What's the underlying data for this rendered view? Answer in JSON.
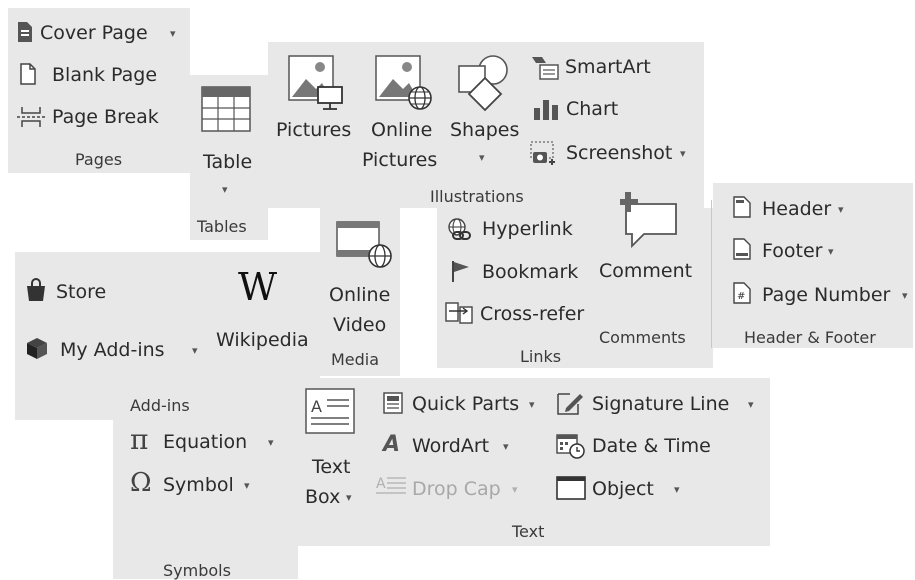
{
  "pages": {
    "cover_page": "Cover Page",
    "blank_page": "Blank Page",
    "page_break": "Page Break",
    "group_label": "Pages"
  },
  "tables": {
    "table_label": "Table",
    "group_label": "Tables"
  },
  "illustrations": {
    "pictures": "Pictures",
    "online_line1": "Online",
    "online_line2": "Pictures",
    "shapes": "Shapes",
    "smartart": "SmartArt",
    "chart": "Chart",
    "screenshot": "Screenshot",
    "group_label": "Illustrations"
  },
  "media": {
    "online_line1": "Online",
    "online_line2": "Video",
    "group_label": "Media"
  },
  "links": {
    "hyperlink": "Hyperlink",
    "bookmark": "Bookmark",
    "cross_reference": "Cross-refer",
    "group_label": "Links"
  },
  "comments": {
    "comment": "Comment",
    "group_label": "Comments"
  },
  "header_footer": {
    "header": "Header",
    "footer": "Footer",
    "page_number": "Page Number",
    "group_label": "Header & Footer"
  },
  "addins": {
    "store": "Store",
    "my_addins": "My Add-ins",
    "wikipedia": "Wikipedia",
    "wikipedia_logo": "W",
    "group_label": "Add-ins"
  },
  "symbols": {
    "equation": "Equation",
    "symbol": "Symbol",
    "group_label": "Symbols",
    "pi_glyph": "π",
    "omega_glyph": "Ω"
  },
  "text": {
    "textbox_line1": "Text",
    "textbox_line2": "Box",
    "quick_parts": "Quick Parts",
    "wordart": "WordArt",
    "drop_cap": "Drop Cap",
    "signature_line": "Signature Line",
    "date_time": "Date & Time",
    "object": "Object",
    "group_label": "Text"
  },
  "glyphs": {
    "dropdown": "▾"
  }
}
